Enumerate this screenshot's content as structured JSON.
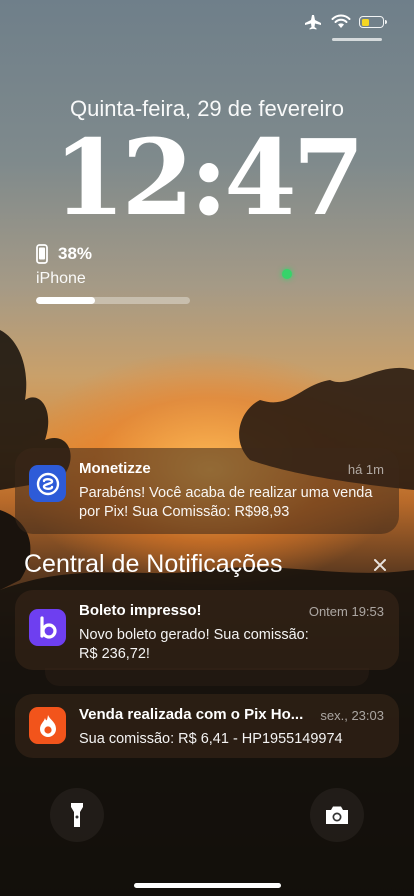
{
  "status": {
    "battery_level": 0.38,
    "battery_color": "#f5d623"
  },
  "lockscreen": {
    "date": "Quinta-feira, 29 de fevereiro",
    "time": "12:47"
  },
  "battery_widget": {
    "percent": "38%",
    "device": "iPhone",
    "level": 0.38
  },
  "top_notification": {
    "app": "Monetizze",
    "time": "há 1m",
    "body": "Parabéns! Você acaba de realizar uma venda por Pix! Sua Comissão: R$98,93",
    "icon": "monetizze-icon",
    "icon_color": "#2d5bd8"
  },
  "notification_center": {
    "title": "Central de Notificações",
    "notifications": [
      {
        "title": "Boleto impresso!",
        "time": "Ontem 19:53",
        "body": "Novo boleto gerado! Sua comissão: R$ 236,72!",
        "icon": "boleto-b-icon",
        "icon_color": "#6e3ff0"
      },
      {
        "title": "Venda realizada com o Pix Ho...",
        "time": "sex., 23:03",
        "body": "Sua comissão: R$ 6,41 - HP1955149974",
        "icon": "flame-icon",
        "icon_color": "#f2541b"
      }
    ]
  },
  "controls": {
    "left": "flashlight-icon",
    "right": "camera-icon"
  }
}
